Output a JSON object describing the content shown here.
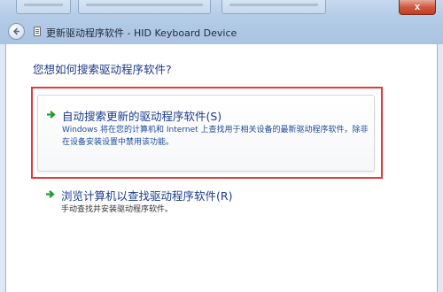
{
  "window": {
    "title": "更新驱动程序软件 - HID Keyboard Device",
    "close_label": "x"
  },
  "dialog": {
    "question": "您想如何搜索驱动程序软件?",
    "options": [
      {
        "title": "自动搜索更新的驱动程序软件(S)",
        "description": "Windows 将在您的计算机和 Internet 上查找用于相关设备的最新驱动程序软件，除非在设备安装设置中禁用该功能。",
        "icon": "green-arrow-icon"
      },
      {
        "title": "浏览计算机以查找驱动程序软件(R)",
        "description": "手动查找并安装驱动程序软件。",
        "icon": "green-arrow-icon"
      }
    ]
  },
  "colors": {
    "highlight": "#e23a3a",
    "link_text": "#1b3b8f",
    "arrow": "#1f9a2e"
  }
}
